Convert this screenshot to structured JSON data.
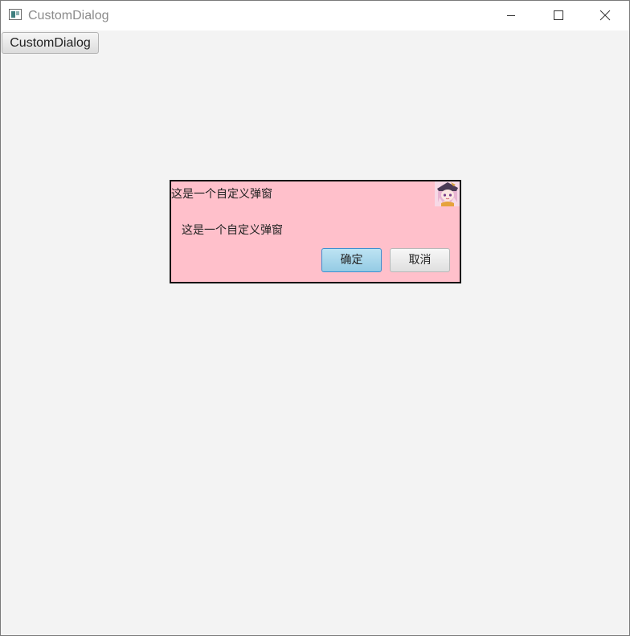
{
  "window": {
    "title": "CustomDialog",
    "controls": {
      "minimize_icon": "minimize-icon",
      "maximize_icon": "maximize-icon",
      "close_icon": "close-icon"
    }
  },
  "main": {
    "open_button_label": "CustomDialog"
  },
  "dialog": {
    "title": "这是一个自定义弹窗",
    "message": "这是一个自定义弹窗",
    "confirm_label": "确定",
    "cancel_label": "取消",
    "avatar_icon": "anime-avatar-icon",
    "background_color": "#ffc0cb",
    "border_color": "#111111"
  }
}
